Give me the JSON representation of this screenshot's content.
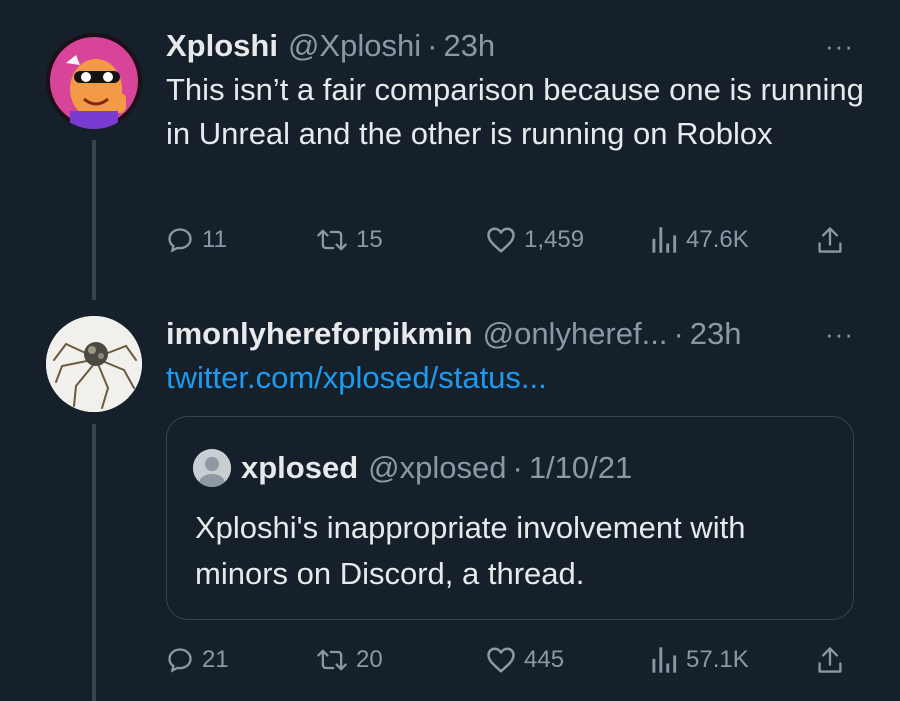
{
  "tweets": [
    {
      "display_name": "Xploshi",
      "handle": "@Xploshi",
      "separator": "·",
      "time": "23h",
      "more": "···",
      "text": "This isn’t a fair comparison because one is running in Unreal and the other is running on Roblox",
      "metrics": {
        "replies": "11",
        "retweets": "15",
        "likes": "1,459",
        "views": "47.6K"
      }
    },
    {
      "display_name": "imonlyhereforpikmin",
      "handle": "@onlyheref...",
      "separator": "·",
      "time": "23h",
      "more": "···",
      "link": "twitter.com/xplosed/status...",
      "quote": {
        "display_name": "xplosed",
        "handle": "@xplosed",
        "separator": "·",
        "date": "1/10/21",
        "text": "Xploshi's inappropriate involvement with minors on Discord, a thread."
      },
      "metrics": {
        "replies": "21",
        "retweets": "20",
        "likes": "445",
        "views": "57.1K"
      }
    }
  ],
  "icons": [
    "reply-icon",
    "retweet-icon",
    "like-icon",
    "views-icon",
    "share-icon",
    "more-icon"
  ],
  "colors": {
    "background": "#15202b",
    "text": "#e7e9ea",
    "muted": "#8b98a5",
    "link": "#1d9bf0",
    "border": "#38444d"
  }
}
